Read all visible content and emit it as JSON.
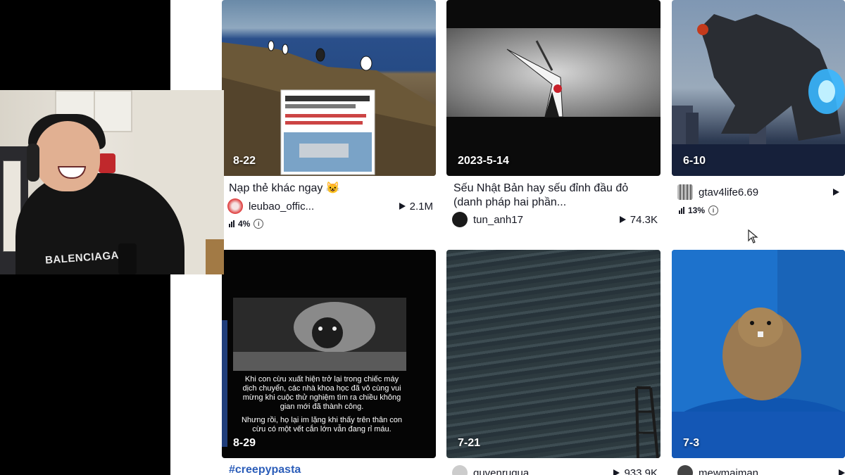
{
  "webcam": {
    "shirt_text": "BALENCIAGA"
  },
  "cards": [
    {
      "date": "8-22",
      "caption": "Nạp thẻ khác ngay 😺",
      "username": "leubao_offic...",
      "views": "2.1M",
      "stat": "4%",
      "screenshot_text": [
        "丹顶鹤打架把鹤也打断了，不过最后的谁都不好看也真是够了!"
      ]
    },
    {
      "date": "2023-5-14",
      "caption": "Sếu Nhật Bản hay sếu đỉnh đầu đỏ (danh pháp hai phần...",
      "username": "tun_anh17",
      "views": "74.3K"
    },
    {
      "date": "6-10",
      "username": "gtav4life6.69",
      "stat": "13%"
    },
    {
      "date": "8-29",
      "overlay_text_1": "Khi con cừu xuất hiện trở lại trong chiếc máy dịch chuyển, các nhà khoa học đã vô cùng vui mừng khi cuộc thử nghiệm tìm ra chiều không gian mới đã thành công.",
      "overlay_text_2": "Nhưng rồi, họ lại im lặng khi thấy trên thân con cừu có một vết cắn lớn vẫn đang rỉ máu.",
      "hashtag": "#creepypasta"
    },
    {
      "date": "7-21",
      "username": "quvenruqua",
      "views": "933.9K"
    },
    {
      "date": "7-3",
      "username": "mewmaiman"
    }
  ],
  "icons": {
    "play": "play-icon",
    "bars": "bar-chart-icon",
    "info": "info-icon",
    "cursor": "mouse-cursor-icon"
  },
  "colors": {
    "hashtag": "#2b5db9",
    "text": "#161823"
  }
}
